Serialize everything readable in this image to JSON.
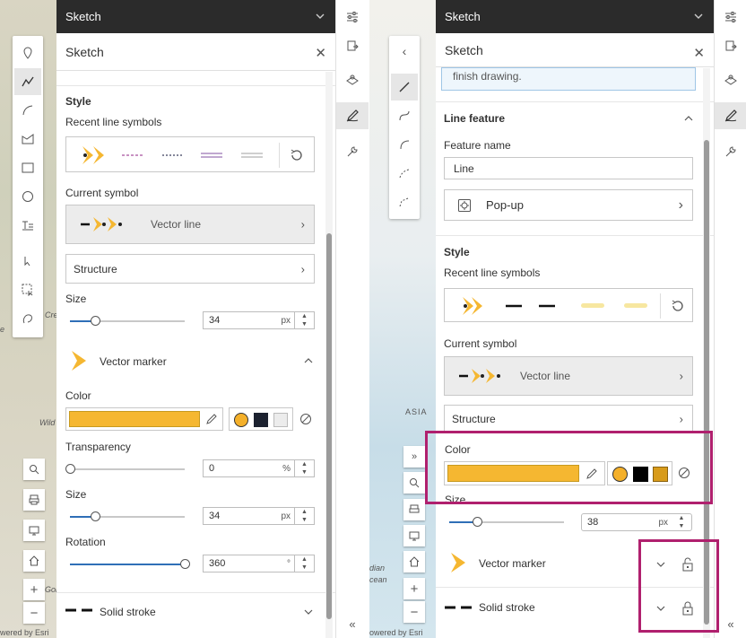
{
  "map": {
    "label_wild": "Wild",
    "label_cre": "Cre",
    "label_e": "e",
    "label_asia": "ASIA",
    "label_indian": "dian",
    "label_ocean": "cean",
    "label_golf": "Gol",
    "attribution_left": "wered by Esri",
    "attribution_right": "owered by Esri"
  },
  "left_panel": {
    "header_title": "Sketch",
    "panel_title": "Sketch",
    "style_heading": "Style",
    "recent_label": "Recent line symbols",
    "current_label": "Current symbol",
    "current_value": "Vector line",
    "structure_label": "Structure",
    "size_label": "Size",
    "size_value": "34",
    "size_unit": "px",
    "marker_label": "Vector marker",
    "color_label": "Color",
    "color_value": "#f5b731",
    "transparency_label": "Transparency",
    "transparency_value": "0",
    "transparency_unit": "%",
    "size2_label": "Size",
    "size2_value": "34",
    "size2_unit": "px",
    "rotation_label": "Rotation",
    "rotation_value": "360",
    "rotation_unit": "°",
    "stroke_label": "Solid stroke"
  },
  "right_panel": {
    "header_title": "Sketch",
    "panel_title": "Sketch",
    "hint_text": "finish drawing.",
    "line_feature_heading": "Line feature",
    "feature_name_label": "Feature name",
    "feature_name_value": "Line",
    "popup_label": "Pop-up",
    "style_heading": "Style",
    "recent_label": "Recent line symbols",
    "current_label": "Current symbol",
    "current_value": "Vector line",
    "structure_label": "Structure",
    "color_label": "Color",
    "color_value": "#f5b731",
    "size_label": "Size",
    "size_value": "38",
    "size_unit": "px",
    "marker_label": "Vector marker",
    "stroke_label": "Solid stroke"
  },
  "colors": {
    "accent_yellow": "#f5b731",
    "swatch_yellow": "#f4b02a",
    "swatch_navy": "#1c2230",
    "swatch_gray": "#ececec",
    "swatch_black": "#000000",
    "swatch_gold": "#d89b1a",
    "highlight": "#b0206e",
    "header_bg": "#2b2b2b"
  }
}
